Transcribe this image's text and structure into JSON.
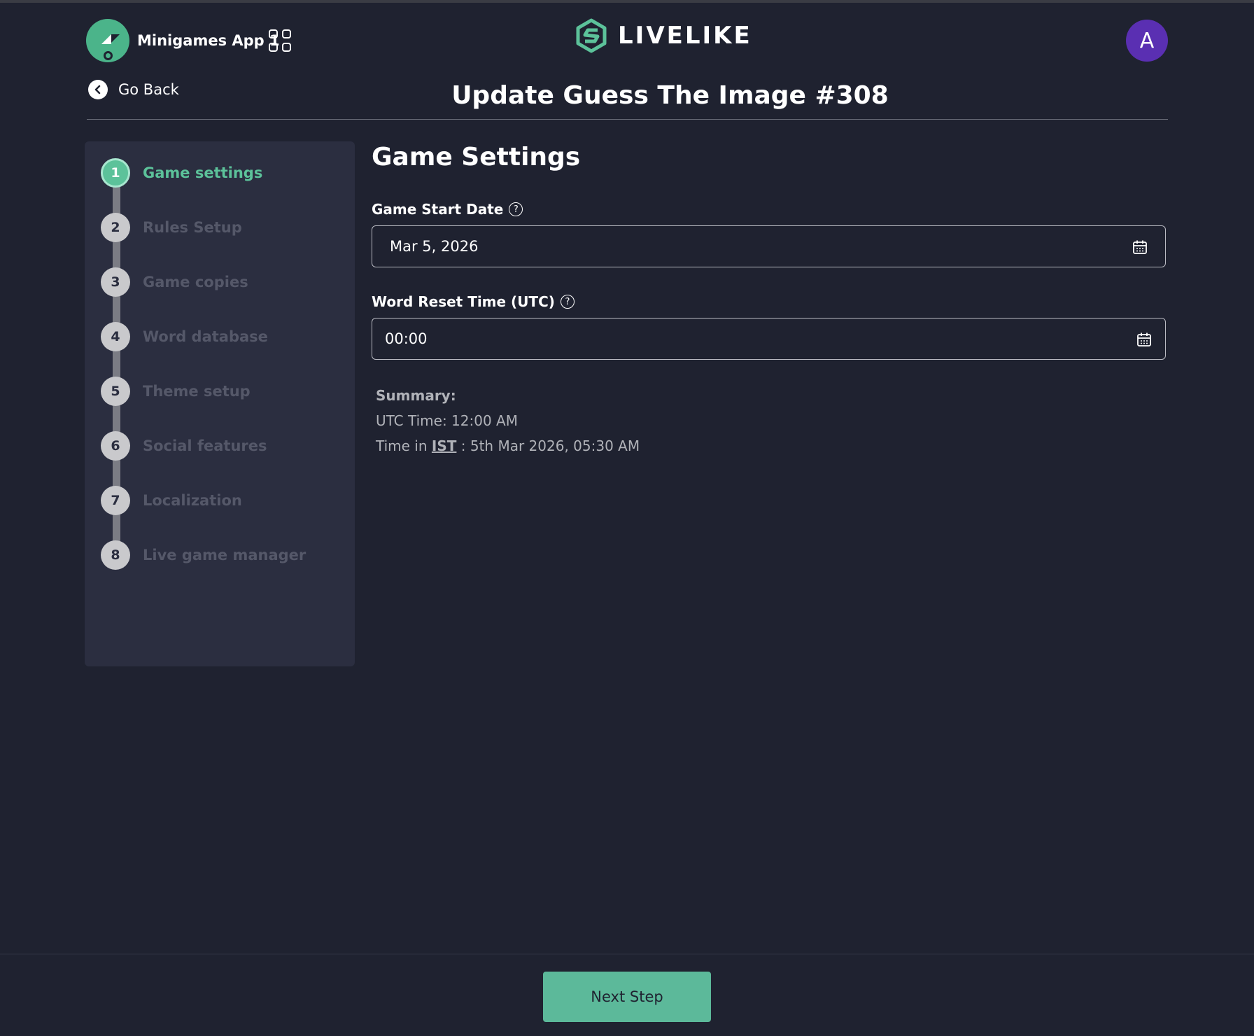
{
  "header": {
    "app_name": "Minigames App 1",
    "brand_name": "LIVELIKE",
    "avatar_initial": "A",
    "go_back_label": "Go Back",
    "page_title": "Update Guess The Image #308"
  },
  "stepper": {
    "steps": [
      {
        "number": "1",
        "label": "Game settings",
        "active": true
      },
      {
        "number": "2",
        "label": "Rules Setup",
        "active": false
      },
      {
        "number": "3",
        "label": "Game copies",
        "active": false
      },
      {
        "number": "4",
        "label": "Word database",
        "active": false
      },
      {
        "number": "5",
        "label": "Theme setup",
        "active": false
      },
      {
        "number": "6",
        "label": "Social features",
        "active": false
      },
      {
        "number": "7",
        "label": "Localization",
        "active": false
      },
      {
        "number": "8",
        "label": "Live game manager",
        "active": false
      }
    ]
  },
  "form": {
    "section_title": "Game Settings",
    "start_date_label": "Game Start Date",
    "start_date_value": "Mar 5, 2026",
    "reset_time_label": "Word Reset Time (UTC)",
    "reset_time_value": "00:00",
    "help_glyph": "?"
  },
  "summary": {
    "title": "Summary:",
    "utc_line": "UTC Time: 12:00 AM",
    "local_prefix": "Time in ",
    "local_tz": "IST",
    "local_suffix": " : 5th Mar 2026, 05:30 AM"
  },
  "footer": {
    "next_label": "Next Step"
  },
  "colors": {
    "background": "#1f2230",
    "sidebar": "#2b2e40",
    "accent": "#5cc29a",
    "avatar": "#5a2fb2"
  }
}
